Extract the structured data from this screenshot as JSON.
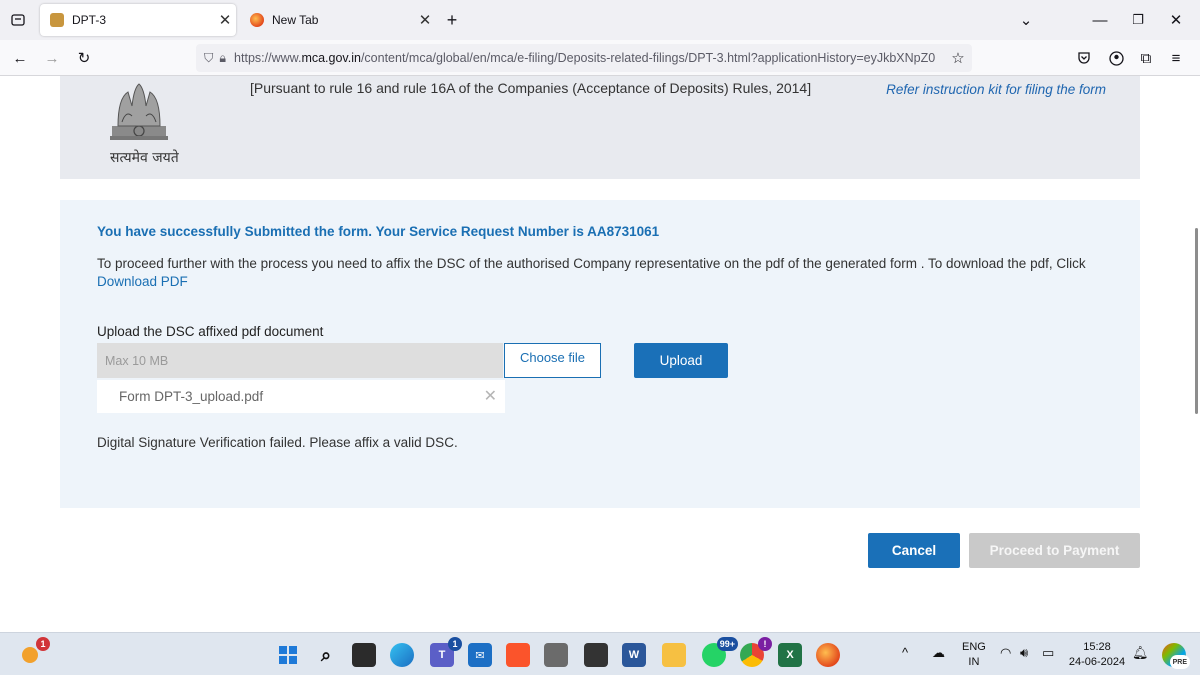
{
  "browser": {
    "tabs": [
      {
        "title": "DPT-3",
        "active": true
      },
      {
        "title": "New Tab",
        "active": false
      }
    ],
    "url": {
      "prefix": "https://www.",
      "domain": "mca.gov.in",
      "path": "/content/mca/global/en/mca/e-filing/Deposits-related-filings/DPT-3.html?applicationHistory=eyJkbXNpZ0"
    }
  },
  "header": {
    "emblem_text": "सत्यमेव जयते",
    "rule_text": "[Pursuant to rule 16 and rule 16A of the Companies (Acceptance of Deposits) Rules, 2014]",
    "kit_link": "Refer instruction kit for filing the form"
  },
  "main": {
    "success_message": "You have successfully Submitted the form. Your Service Request Number is AA8731061",
    "proceed_text": "To proceed further with the process you need to affix the DSC of the authorised Company representative on the pdf of the generated form . To download the pdf, Click",
    "download_link": "Download PDF",
    "upload_label": "Upload the DSC affixed pdf document",
    "file_input_placeholder": "Max 10 MB",
    "choose_file_label": "Choose file",
    "upload_button": "Upload",
    "uploaded_file": "Form DPT-3_upload.pdf",
    "error_message": "Digital Signature Verification failed. Please affix a valid DSC."
  },
  "footer_buttons": {
    "cancel": "Cancel",
    "proceed": "Proceed to Payment"
  },
  "taskbar": {
    "language": "ENG",
    "region": "IN",
    "time": "15:28",
    "date": "24-06-2024",
    "badges": {
      "weather": "1",
      "teams": "1",
      "whatsapp": "99+",
      "chrome": "!"
    },
    "corner_badge": "PRE"
  },
  "colors": {
    "accent": "#1a70b8",
    "success_text": "#1a6fb3",
    "panel_bg": "#eef4fa",
    "header_bg": "#e8eaef",
    "disabled": "#c9c9c9"
  }
}
